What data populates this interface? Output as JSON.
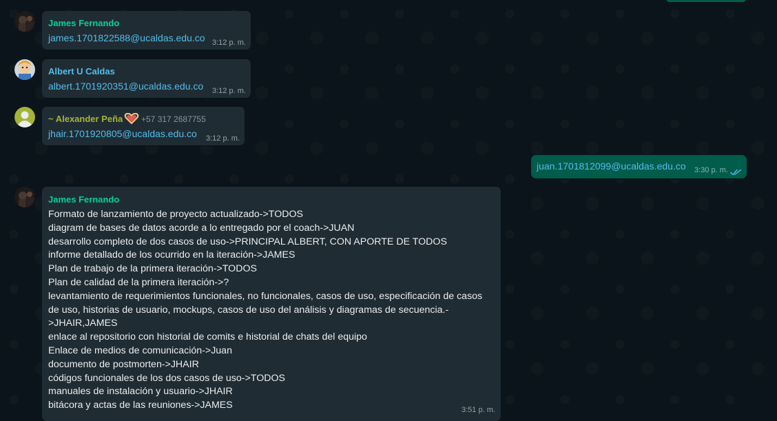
{
  "messages": [
    {
      "sender": "James Fernando",
      "text": "james.1701822588@ucaldas.edu.co",
      "time": "3:12 p. m."
    },
    {
      "sender": "Albert U Caldas",
      "text": "albert.1701920351@ucaldas.edu.co",
      "time": "3:12 p. m."
    },
    {
      "sender": "~ Alexander Peña",
      "phone": "+57 317 2687755",
      "text": "jhair.1701920805@ucaldas.edu.co",
      "time": "3:12 p. m."
    },
    {
      "sender": "James Fernando",
      "time": "3:51 p. m.",
      "lines": [
        "Formato de lanzamiento de proyecto actualizado->TODOS",
        "diagram de bases de datos acorde a lo entregado por el coach->JUAN",
        "desarrollo completo de dos casos de uso->PRINCIPAL ALBERT, CON APORTE DE TODOS",
        "informe detallado de los ocurrido en la iteración->JAMES",
        "Plan de trabajo de la primera iteración->TODOS",
        "Plan de calidad de la primera iteración->?",
        "levantamiento de requerimientos funcionales, no funcionales, casos de uso, especificación de casos",
        "de uso, historias de usuario, mockups, casos de uso del análisis y diagramas de secuencia.-",
        ">JHAIR,JAMES",
        "enlace al repositorio con historial de comits e historial de chats del equipo",
        "Enlace de medios de comunicación->Juan",
        "documento de postmorten->JHAIR",
        "códigos funcionales de los dos casos de uso->TODOS",
        "manuales de instalación y usuario->JHAIR",
        "bitácora y actas de las reuniones->JAMES"
      ]
    }
  ],
  "outgoing": {
    "text": "juan.1701812099@ucaldas.edu.co",
    "time": "3:30 p. m.",
    "status_icon": "double-check-read-icon"
  },
  "colors": {
    "background": "#0b141a",
    "incoming_bubble": "#202c33",
    "outgoing_bubble": "#005c4b",
    "link": "#53bdeb",
    "sender_green": "#06cf9c",
    "sender_blue": "#53bdeb",
    "sender_yellow": "#a5b337",
    "read_check": "#53bdeb"
  }
}
